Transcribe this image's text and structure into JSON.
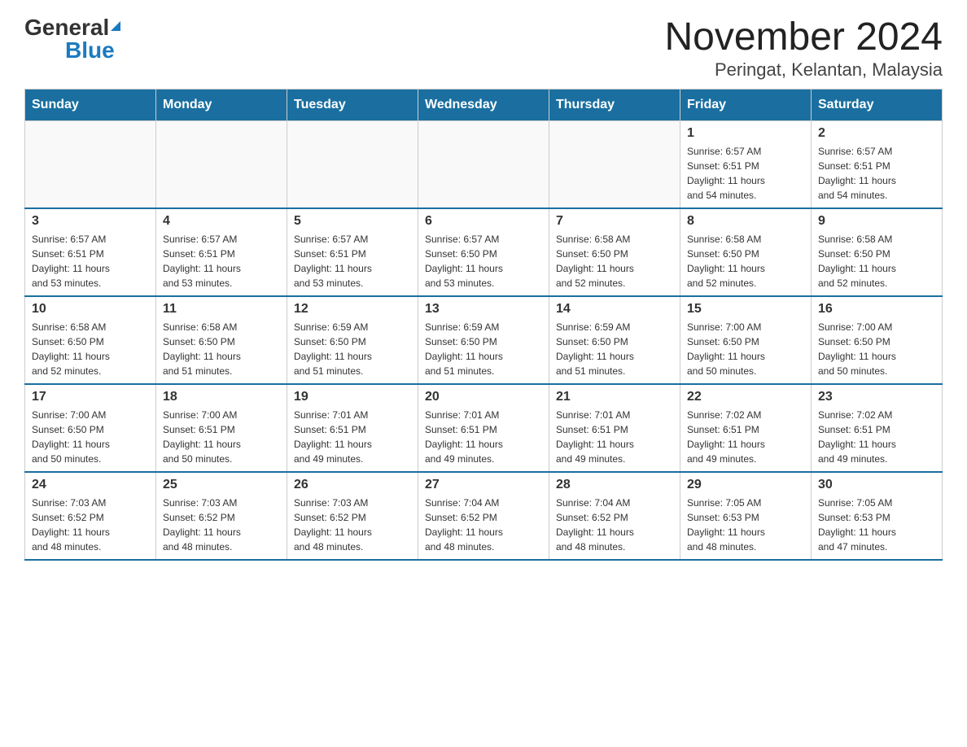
{
  "logo": {
    "general": "General",
    "blue": "Blue"
  },
  "title": "November 2024",
  "subtitle": "Peringat, Kelantan, Malaysia",
  "weekdays": [
    "Sunday",
    "Monday",
    "Tuesday",
    "Wednesday",
    "Thursday",
    "Friday",
    "Saturday"
  ],
  "weeks": [
    [
      {
        "day": "",
        "info": ""
      },
      {
        "day": "",
        "info": ""
      },
      {
        "day": "",
        "info": ""
      },
      {
        "day": "",
        "info": ""
      },
      {
        "day": "",
        "info": ""
      },
      {
        "day": "1",
        "info": "Sunrise: 6:57 AM\nSunset: 6:51 PM\nDaylight: 11 hours\nand 54 minutes."
      },
      {
        "day": "2",
        "info": "Sunrise: 6:57 AM\nSunset: 6:51 PM\nDaylight: 11 hours\nand 54 minutes."
      }
    ],
    [
      {
        "day": "3",
        "info": "Sunrise: 6:57 AM\nSunset: 6:51 PM\nDaylight: 11 hours\nand 53 minutes."
      },
      {
        "day": "4",
        "info": "Sunrise: 6:57 AM\nSunset: 6:51 PM\nDaylight: 11 hours\nand 53 minutes."
      },
      {
        "day": "5",
        "info": "Sunrise: 6:57 AM\nSunset: 6:51 PM\nDaylight: 11 hours\nand 53 minutes."
      },
      {
        "day": "6",
        "info": "Sunrise: 6:57 AM\nSunset: 6:50 PM\nDaylight: 11 hours\nand 53 minutes."
      },
      {
        "day": "7",
        "info": "Sunrise: 6:58 AM\nSunset: 6:50 PM\nDaylight: 11 hours\nand 52 minutes."
      },
      {
        "day": "8",
        "info": "Sunrise: 6:58 AM\nSunset: 6:50 PM\nDaylight: 11 hours\nand 52 minutes."
      },
      {
        "day": "9",
        "info": "Sunrise: 6:58 AM\nSunset: 6:50 PM\nDaylight: 11 hours\nand 52 minutes."
      }
    ],
    [
      {
        "day": "10",
        "info": "Sunrise: 6:58 AM\nSunset: 6:50 PM\nDaylight: 11 hours\nand 52 minutes."
      },
      {
        "day": "11",
        "info": "Sunrise: 6:58 AM\nSunset: 6:50 PM\nDaylight: 11 hours\nand 51 minutes."
      },
      {
        "day": "12",
        "info": "Sunrise: 6:59 AM\nSunset: 6:50 PM\nDaylight: 11 hours\nand 51 minutes."
      },
      {
        "day": "13",
        "info": "Sunrise: 6:59 AM\nSunset: 6:50 PM\nDaylight: 11 hours\nand 51 minutes."
      },
      {
        "day": "14",
        "info": "Sunrise: 6:59 AM\nSunset: 6:50 PM\nDaylight: 11 hours\nand 51 minutes."
      },
      {
        "day": "15",
        "info": "Sunrise: 7:00 AM\nSunset: 6:50 PM\nDaylight: 11 hours\nand 50 minutes."
      },
      {
        "day": "16",
        "info": "Sunrise: 7:00 AM\nSunset: 6:50 PM\nDaylight: 11 hours\nand 50 minutes."
      }
    ],
    [
      {
        "day": "17",
        "info": "Sunrise: 7:00 AM\nSunset: 6:50 PM\nDaylight: 11 hours\nand 50 minutes."
      },
      {
        "day": "18",
        "info": "Sunrise: 7:00 AM\nSunset: 6:51 PM\nDaylight: 11 hours\nand 50 minutes."
      },
      {
        "day": "19",
        "info": "Sunrise: 7:01 AM\nSunset: 6:51 PM\nDaylight: 11 hours\nand 49 minutes."
      },
      {
        "day": "20",
        "info": "Sunrise: 7:01 AM\nSunset: 6:51 PM\nDaylight: 11 hours\nand 49 minutes."
      },
      {
        "day": "21",
        "info": "Sunrise: 7:01 AM\nSunset: 6:51 PM\nDaylight: 11 hours\nand 49 minutes."
      },
      {
        "day": "22",
        "info": "Sunrise: 7:02 AM\nSunset: 6:51 PM\nDaylight: 11 hours\nand 49 minutes."
      },
      {
        "day": "23",
        "info": "Sunrise: 7:02 AM\nSunset: 6:51 PM\nDaylight: 11 hours\nand 49 minutes."
      }
    ],
    [
      {
        "day": "24",
        "info": "Sunrise: 7:03 AM\nSunset: 6:52 PM\nDaylight: 11 hours\nand 48 minutes."
      },
      {
        "day": "25",
        "info": "Sunrise: 7:03 AM\nSunset: 6:52 PM\nDaylight: 11 hours\nand 48 minutes."
      },
      {
        "day": "26",
        "info": "Sunrise: 7:03 AM\nSunset: 6:52 PM\nDaylight: 11 hours\nand 48 minutes."
      },
      {
        "day": "27",
        "info": "Sunrise: 7:04 AM\nSunset: 6:52 PM\nDaylight: 11 hours\nand 48 minutes."
      },
      {
        "day": "28",
        "info": "Sunrise: 7:04 AM\nSunset: 6:52 PM\nDaylight: 11 hours\nand 48 minutes."
      },
      {
        "day": "29",
        "info": "Sunrise: 7:05 AM\nSunset: 6:53 PM\nDaylight: 11 hours\nand 48 minutes."
      },
      {
        "day": "30",
        "info": "Sunrise: 7:05 AM\nSunset: 6:53 PM\nDaylight: 11 hours\nand 47 minutes."
      }
    ]
  ]
}
